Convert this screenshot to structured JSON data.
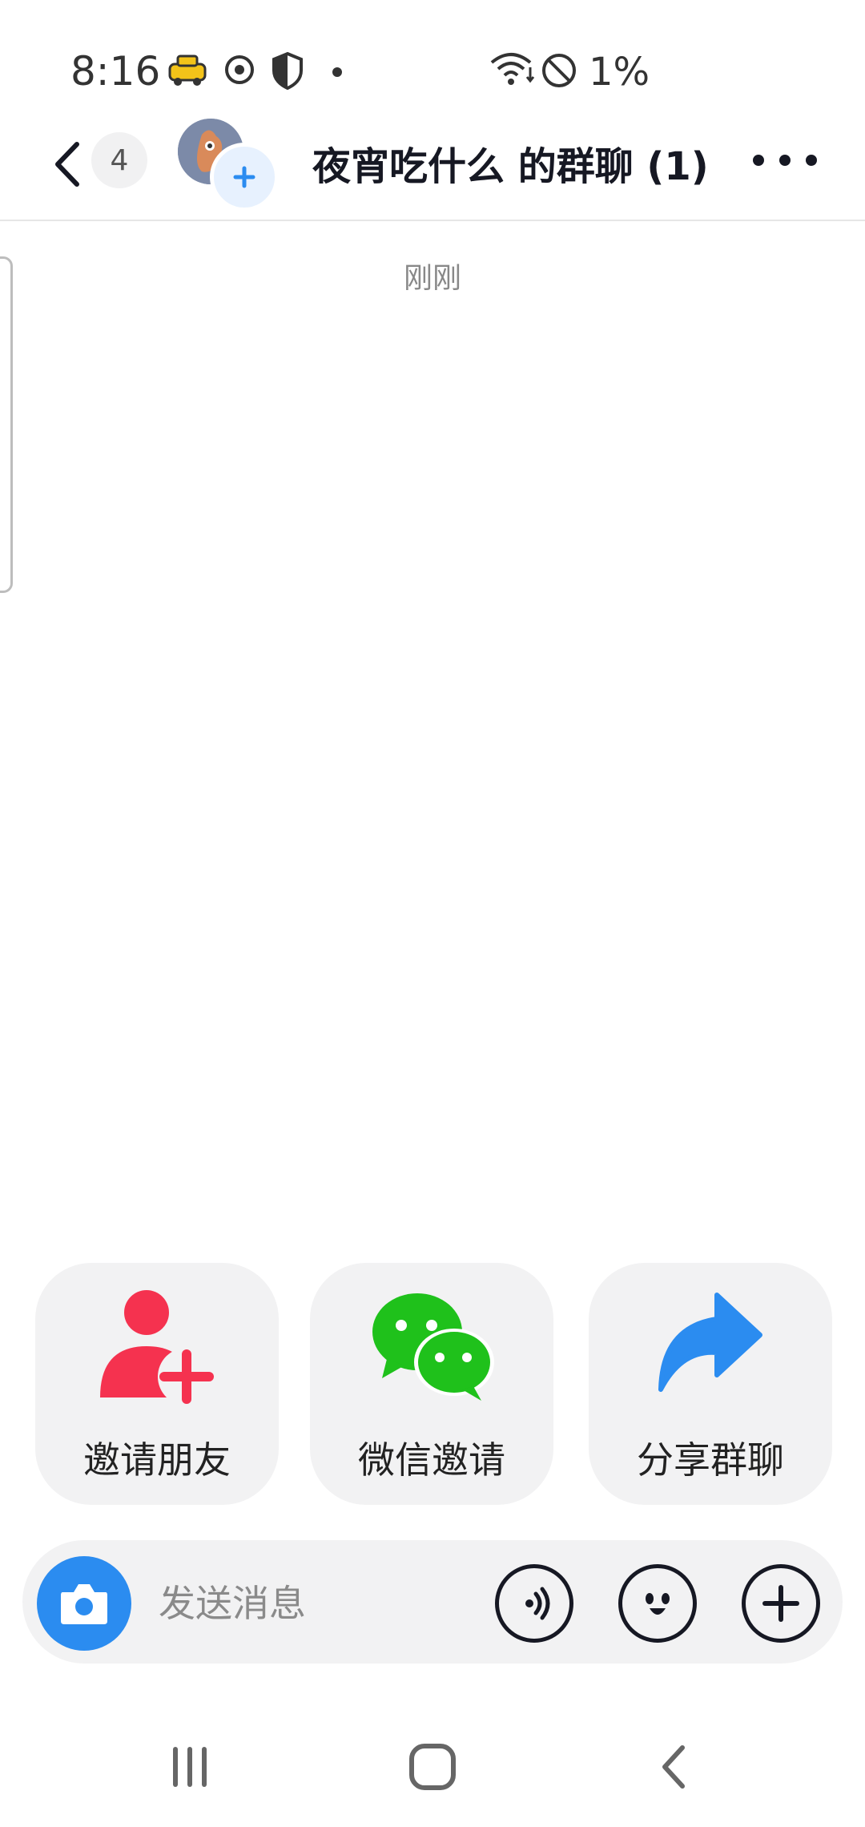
{
  "status_bar": {
    "time": "8:16",
    "battery": "1%",
    "icons": [
      "taxi-icon",
      "sync-icon",
      "shield-icon",
      "dot-icon",
      "wifi-icon",
      "do-not-disturb-icon"
    ]
  },
  "header": {
    "unread_count": "4",
    "title": "夜宵吃什么 的群聊 (1)"
  },
  "chat": {
    "timestamp": "刚刚"
  },
  "actions": {
    "invite_friends": "邀请朋友",
    "wechat_invite": "微信邀请",
    "share_group": "分享群聊"
  },
  "input_bar": {
    "placeholder": "发送消息"
  },
  "colors": {
    "accent_blue": "#2b8cf0",
    "invite_red": "#f5324f",
    "wechat_green": "#1fc11b",
    "share_blue": "#2b8cf0"
  }
}
